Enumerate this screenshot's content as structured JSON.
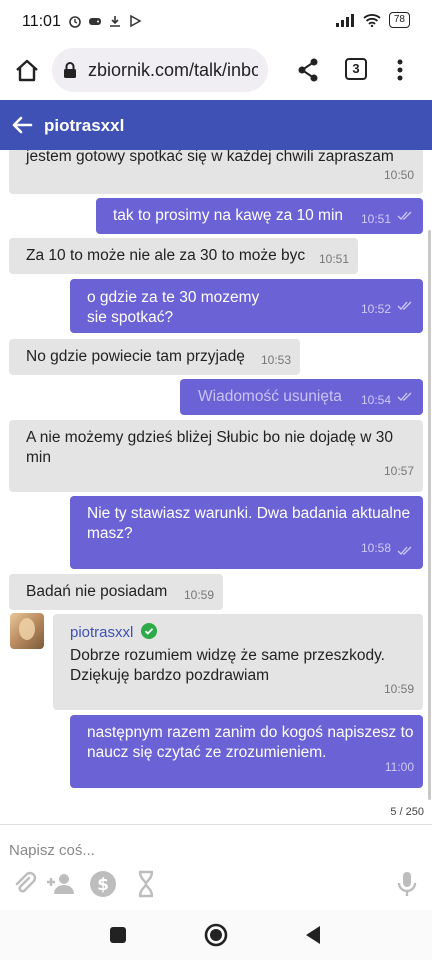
{
  "status": {
    "time": "11:01",
    "battery": "78"
  },
  "browser": {
    "url": "zbiornik.com/talk/inbo",
    "tab_count": "3"
  },
  "header": {
    "title": "piotrasxxl"
  },
  "messages": [
    {
      "dir": "in",
      "text": "jestem gotowy spotkać się w każdej chwili zapraszam",
      "time": "10:50"
    },
    {
      "dir": "out",
      "text": "tak to prosimy na kawę za 10 min",
      "time": "10:51"
    },
    {
      "dir": "in",
      "text": "Za 10 to może nie ale za 30 to może byc",
      "time": "10:51"
    },
    {
      "dir": "out",
      "text": "o gdzie za te 30 mozemy sie spotkać?",
      "time": "10:52"
    },
    {
      "dir": "in",
      "text": "No gdzie powiecie tam przyjadę",
      "time": "10:53"
    },
    {
      "dir": "out",
      "text": "Wiadomość usunięta",
      "time": "10:54",
      "deleted": true
    },
    {
      "dir": "in",
      "text": "A nie możemy gdzieś bliżej Słubic bo nie dojadę w 30 min",
      "time": "10:57"
    },
    {
      "dir": "out",
      "text": "Nie ty stawiasz warunki. Dwa badania aktualne masz?",
      "time": "10:58"
    },
    {
      "dir": "in",
      "text": "Badań nie posiadam",
      "time": "10:59"
    },
    {
      "dir": "in",
      "sender": "piotrasxxl",
      "text": "Dobrze rozumiem widzę że same przeszkody. Dziękuję bardzo pozdrawiam",
      "time": "10:59"
    },
    {
      "dir": "out",
      "text": "następnym razem zanim do kogoś napiszesz to naucz się czytać ze zrozumieniem.",
      "time": "11:00"
    }
  ],
  "counter": "5 / 250",
  "input": {
    "placeholder": "Napisz coś..."
  },
  "icons": {
    "attach": "paperclip-icon",
    "add_user": "add-person-icon",
    "money": "dollar-icon",
    "timer": "hourglass-icon",
    "mic": "microphone-icon"
  },
  "colors": {
    "header": "#3f51b5",
    "outgoing": "#6b62d6",
    "incoming": "#e4e4e4",
    "verified": "#2eaa4a"
  }
}
